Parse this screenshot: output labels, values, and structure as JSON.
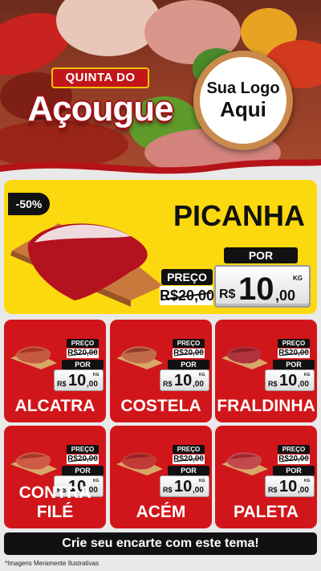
{
  "brand": {
    "top": "QUINTA DO",
    "main": "Açougue"
  },
  "logo": {
    "line1": "Sua Logo",
    "line2": "Aqui"
  },
  "featured": {
    "title": "PICANHA",
    "badge": "-50%",
    "preco_label": "PREÇO",
    "old_price": "R$20,00",
    "por_label": "POR",
    "currency": "R$",
    "price_int": "10",
    "price_dec": ",00",
    "unit": "KG"
  },
  "products": [
    {
      "name": "ALCATRA",
      "preco_label": "PREÇO",
      "old_price": "R$20,00",
      "por_label": "POR",
      "currency": "R$",
      "price_int": "10",
      "price_dec": ",00",
      "unit": "KG"
    },
    {
      "name": "COSTELA",
      "preco_label": "PREÇO",
      "old_price": "R$20,00",
      "por_label": "POR",
      "currency": "R$",
      "price_int": "10",
      "price_dec": ",00",
      "unit": "KG"
    },
    {
      "name": "FRALDINHA",
      "preco_label": "PREÇO",
      "old_price": "R$20,00",
      "por_label": "POR",
      "currency": "R$",
      "price_int": "10",
      "price_dec": ",00",
      "unit": "KG"
    },
    {
      "name": "CONTRA FILÉ",
      "preco_label": "PREÇO",
      "old_price": "R$20,00",
      "por_label": "POR",
      "currency": "R$",
      "price_int": "10",
      "price_dec": ",00",
      "unit": "KG"
    },
    {
      "name": "ACÉM",
      "preco_label": "PREÇO",
      "old_price": "R$20,00",
      "por_label": "POR",
      "currency": "R$",
      "price_int": "10",
      "price_dec": ",00",
      "unit": "KG"
    },
    {
      "name": "PALETA",
      "preco_label": "PREÇO",
      "old_price": "R$20,00",
      "por_label": "POR",
      "currency": "R$",
      "price_int": "10",
      "price_dec": ",00",
      "unit": "KG"
    }
  ],
  "footer": {
    "cta": "Crie seu encarte com este tema!",
    "disclaimer": "*Imagens Meramente Ilustrativas"
  },
  "colors": {
    "red": "#d1161b",
    "yellow": "#fcd90f",
    "black": "#111111"
  }
}
